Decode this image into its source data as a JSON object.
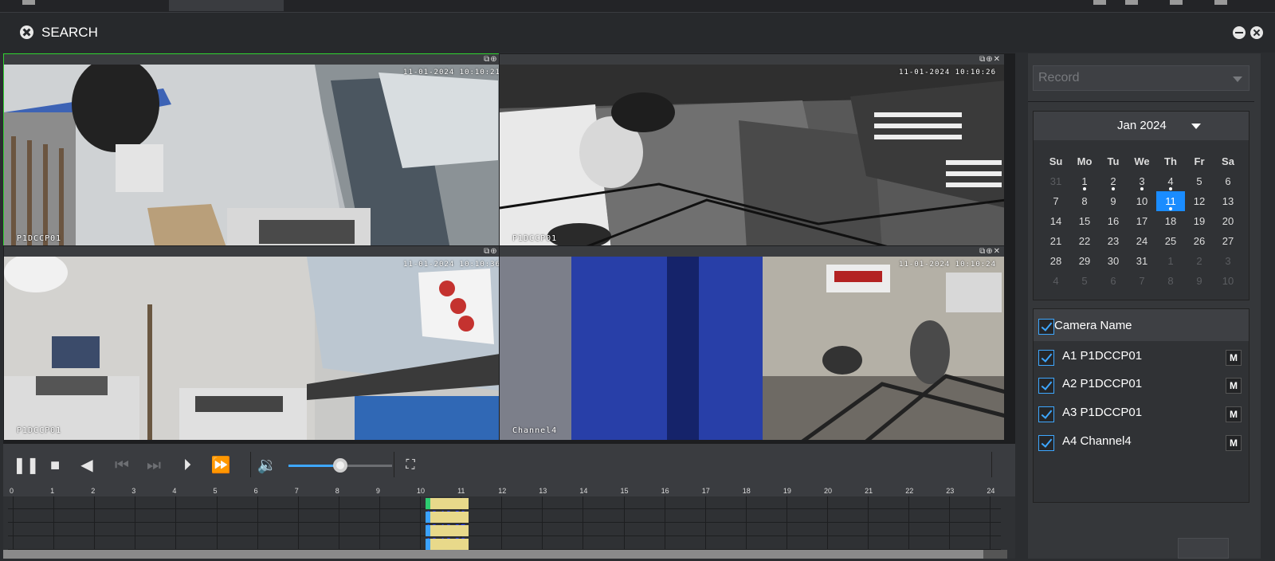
{
  "window": {
    "title": "SEARCH"
  },
  "video": {
    "cameras": [
      {
        "osd_time": "11-01-2024 10:10:21",
        "osd_name": "P1DCCP01",
        "tool_icons": "⧉⊕✕"
      },
      {
        "osd_time": "11-01-2024 10:10:26",
        "osd_name": "P1DCCP01",
        "tool_icons": "⧉⊕✕"
      },
      {
        "osd_time": "11-01-2024 10:10:36",
        "osd_name": "P1DCCP01",
        "tool_icons": "⧉⊕✕"
      },
      {
        "osd_time": "11-01-2024 10:10:24",
        "osd_name": "Channel4",
        "tool_icons": "⧉⊕✕"
      }
    ]
  },
  "controls": {
    "volume_level": 0.5
  },
  "timeline": {
    "hours": [
      "0",
      "1",
      "2",
      "3",
      "4",
      "5",
      "6",
      "7",
      "8",
      "9",
      "10",
      "11",
      "12",
      "13",
      "14",
      "15",
      "16",
      "17",
      "18",
      "19",
      "20",
      "21",
      "22",
      "23",
      "24"
    ],
    "segments": [
      "10:10:20",
      "10:10:25",
      "10:10:38",
      "10:10:23"
    ]
  },
  "sidebar": {
    "record_type": "Record",
    "calendar": {
      "month_label": "Jan 2024",
      "weekdays": [
        "Su",
        "Mo",
        "Tu",
        "We",
        "Th",
        "Fr",
        "Sa"
      ],
      "weeks": [
        [
          "31",
          "1",
          "2",
          "3",
          "4",
          "5",
          "6"
        ],
        [
          "7",
          "8",
          "9",
          "10",
          "11",
          "12",
          "13"
        ],
        [
          "14",
          "15",
          "16",
          "17",
          "18",
          "19",
          "20"
        ],
        [
          "21",
          "22",
          "23",
          "24",
          "25",
          "26",
          "27"
        ],
        [
          "28",
          "29",
          "30",
          "31",
          "1",
          "2",
          "3"
        ],
        [
          "4",
          "5",
          "6",
          "7",
          "8",
          "9",
          "10"
        ]
      ],
      "selected_day": "11",
      "days_with_records": [
        "1",
        "2",
        "3",
        "4",
        "11"
      ]
    },
    "camera_list": {
      "header": "Camera Name",
      "items": [
        {
          "label": "A1 P1DCCP01",
          "m": "M"
        },
        {
          "label": "A2 P1DCCP01",
          "m": "M"
        },
        {
          "label": "A3 P1DCCP01",
          "m": "M"
        },
        {
          "label": "A4 Channel4",
          "m": "M"
        }
      ]
    }
  }
}
